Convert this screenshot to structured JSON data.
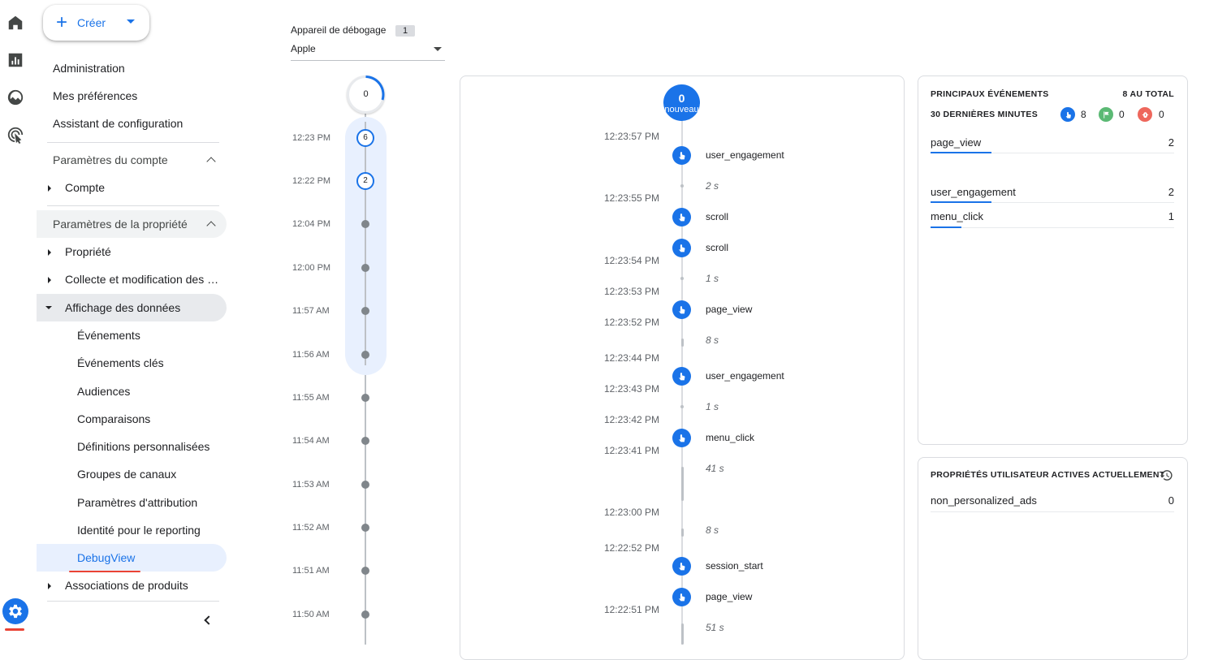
{
  "nav": {
    "create_label": "Créer",
    "top_items": [
      "Administration",
      "Mes préférences",
      "Assistant de configuration"
    ],
    "account_section": "Paramètres du compte",
    "account_items": [
      "Compte"
    ],
    "property_section": "Paramètres de la propriété",
    "property_items": [
      "Propriété",
      "Collecte et modification des …",
      "Affichage des données"
    ],
    "display_subitems": [
      "Événements",
      "Événements clés",
      "Audiences",
      "Comparaisons",
      "Définitions personnalisées",
      "Groupes de canaux",
      "Paramètres d'attribution",
      "Identité pour le reporting",
      "DebugView"
    ],
    "bottom_item": "Associations de produits",
    "active_item": "DebugView"
  },
  "device": {
    "label": "Appareil de débogage",
    "count": "1",
    "value": "Apple"
  },
  "minutes": {
    "top_count": "0",
    "rows": [
      {
        "time": "12:23 PM",
        "count": "6"
      },
      {
        "time": "12:22 PM",
        "count": "2"
      },
      {
        "time": "12:04 PM",
        "count": ""
      },
      {
        "time": "12:00 PM",
        "count": ""
      },
      {
        "time": "11:57 AM",
        "count": ""
      },
      {
        "time": "11:56 AM",
        "count": ""
      },
      {
        "time": "11:55 AM",
        "count": ""
      },
      {
        "time": "11:54 AM",
        "count": ""
      },
      {
        "time": "11:53 AM",
        "count": ""
      },
      {
        "time": "11:52 AM",
        "count": ""
      },
      {
        "time": "11:51 AM",
        "count": ""
      },
      {
        "time": "11:50 AM",
        "count": ""
      }
    ]
  },
  "seconds": {
    "new_count": "0",
    "new_label": "nouveau",
    "timestamps": [
      "12:23:57 PM",
      "12:23:55 PM",
      "12:23:54 PM",
      "12:23:53 PM",
      "12:23:52 PM",
      "12:23:44 PM",
      "12:23:43 PM",
      "12:23:42 PM",
      "12:23:41 PM",
      "12:23:00 PM",
      "12:22:52 PM",
      "12:22:51 PM"
    ],
    "events": [
      "user_engagement",
      "scroll",
      "scroll",
      "page_view",
      "user_engagement",
      "menu_click",
      "session_start",
      "page_view"
    ],
    "gaps": [
      "2 s",
      "1 s",
      "8 s",
      "1 s",
      "41 s",
      "8 s",
      "51 s"
    ]
  },
  "top_events": {
    "title": "PRINCIPAUX ÉVÉNEMENTS",
    "total": "8 AU TOTAL",
    "subtitle": "30 DERNIÈRES MINUTES",
    "counts": {
      "events": "8",
      "key_events": "0",
      "errors": "0"
    },
    "rows": [
      {
        "name": "page_view",
        "value": "2"
      },
      {
        "name": "user_engagement",
        "value": "2"
      },
      {
        "name": "menu_click",
        "value": "1"
      }
    ]
  },
  "user_props": {
    "title": "PROPRIÉTÉS UTILISATEUR ACTIVES ACTUELLEMENT",
    "rows": [
      {
        "name": "non_personalized_ads",
        "value": "0"
      }
    ]
  },
  "colors": {
    "accent": "#1a73e8",
    "highlight": "#e8f0fe",
    "green": "#5bb974",
    "orange": "#ee675c"
  }
}
